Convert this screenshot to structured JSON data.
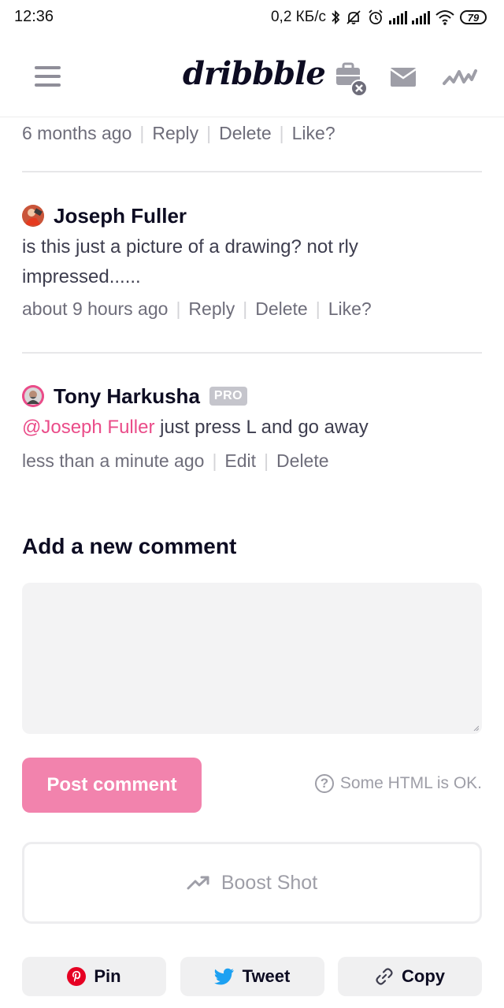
{
  "status_bar": {
    "time": "12:36",
    "network_speed": "0,2 КБ/с",
    "battery": "79"
  },
  "header": {
    "logo": "dribbble",
    "menu_icon": "hamburger-menu-icon",
    "icons": [
      "briefcase-closed-icon",
      "mail-icon",
      "activity-icon"
    ]
  },
  "comments": [
    {
      "meta_time": "6 months ago",
      "actions": [
        "Reply",
        "Delete",
        "Like?"
      ]
    },
    {
      "author": "Joseph Fuller",
      "body": "is this just a picture of a drawing? not rly impressed......",
      "meta_time": "about 9 hours ago",
      "actions": [
        "Reply",
        "Delete",
        "Like?"
      ]
    },
    {
      "author": "Tony Harkusha",
      "badge": "PRO",
      "mention": "@Joseph Fuller",
      "body": " just press L and go away",
      "meta_time": "less than a minute ago",
      "actions": [
        "Edit",
        "Delete"
      ]
    }
  ],
  "add_comment": {
    "title": "Add a new comment",
    "textarea_value": "",
    "post_button": "Post comment",
    "hint": "Some HTML is OK."
  },
  "boost_button": "Boost Shot",
  "share": {
    "pin": "Pin",
    "tweet": "Tweet",
    "copy": "Copy"
  },
  "colors": {
    "brand_pink": "#ea4c89",
    "post_button_bg": "#f283ad",
    "text_dark": "#0d0c22",
    "meta_gray": "#6e6d7a",
    "pinterest_red": "#e60023",
    "twitter_blue": "#1da1f2"
  }
}
